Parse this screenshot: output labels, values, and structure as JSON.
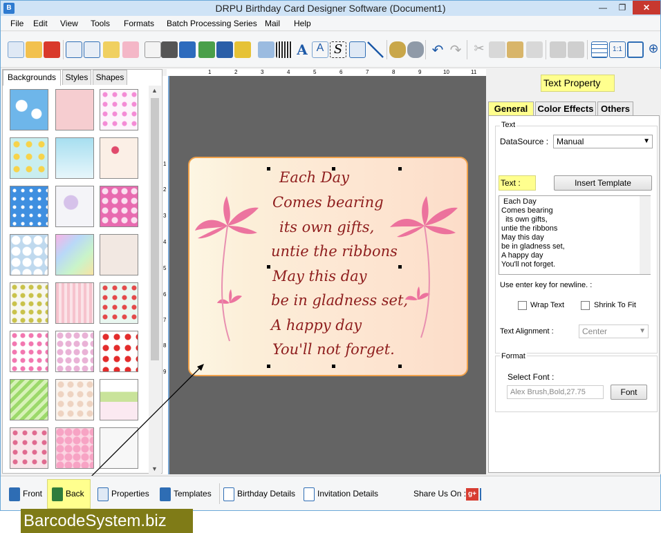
{
  "window": {
    "title": "DRPU Birthday Card Designer Software (Document1)",
    "min_glyph": "—",
    "max_glyph": "❐",
    "close_glyph": "✕"
  },
  "menu": [
    "File",
    "Edit",
    "View",
    "Tools",
    "Formats",
    "Batch Processing Series",
    "Mail",
    "Help"
  ],
  "left_panel": {
    "tabs": [
      "Backgrounds",
      "Styles",
      "Shapes"
    ],
    "active_tab": "Backgrounds",
    "scroll_up": "▲",
    "scroll_down": "▼"
  },
  "ruler": {
    "h_numbers": [
      "1",
      "2",
      "3",
      "4",
      "5",
      "6",
      "7",
      "8",
      "9",
      "10",
      "11"
    ],
    "v_numbers": [
      "1",
      "2",
      "3",
      "4",
      "5",
      "6",
      "7",
      "8",
      "9"
    ]
  },
  "card": {
    "lines": [
      "Each Day",
      "Comes bearing",
      "its own gifts,",
      "untie the ribbons",
      "May this day",
      "be in gladness set,",
      "A happy day",
      "You'll not forget."
    ]
  },
  "right_panel": {
    "title": "Text Property",
    "tabs": [
      "General",
      "Color Effects",
      "Others"
    ],
    "active_tab": "General",
    "text_group": "Text",
    "datasource_label": "DataSource :",
    "datasource_value": "Manual",
    "text_label": "Text :",
    "insert_template": "Insert Template",
    "text_value": " Each Day\nComes bearing\n  its own gifts,\nuntie the ribbons\nMay this day\nbe in gladness set,\nA happy day\nYou'll not forget.",
    "newline_hint": "Use enter key for newline. :",
    "wrap_text": "Wrap Text",
    "shrink_to_fit": "Shrink To Fit",
    "alignment_label": "Text Alignment :",
    "alignment_value": "Center",
    "format_group": "Format",
    "select_font_label": "Select Font :",
    "font_value": "Alex Brush,Bold,27.75",
    "font_button": "Font"
  },
  "bottom_bar": {
    "front": "Front",
    "back": "Back",
    "properties": "Properties",
    "templates": "Templates",
    "birthday_details": "Birthday Details",
    "invitation_details": "Invitation Details",
    "share_label": "Share Us On :",
    "share_glyph": "g+"
  },
  "watermark": "BarcodeSystem.biz",
  "colors": {
    "highlight": "#ffff8e",
    "card_text": "#8e1d1d",
    "card_border": "#f0a14a",
    "canvas_bg": "#646464"
  }
}
